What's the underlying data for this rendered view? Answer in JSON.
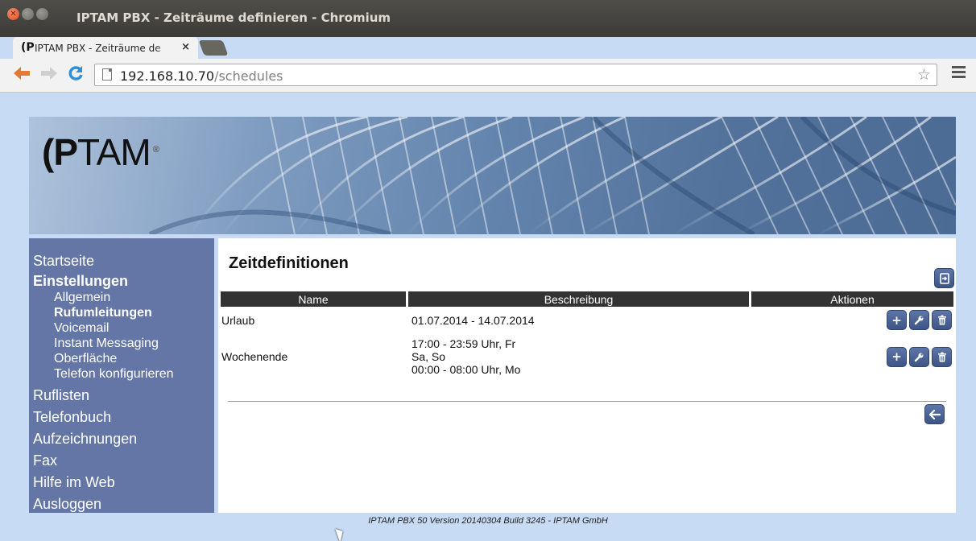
{
  "window": {
    "title": "IPTAM PBX - Zeiträume definieren - Chromium",
    "close_glyph": "✕"
  },
  "tab": {
    "favicon_text": "(P",
    "title": "IPTAM PBX - Zeiträume de",
    "close_glyph": "×"
  },
  "toolbar": {
    "url_host": "192.168.10.70",
    "url_path": "/schedules",
    "back_glyph": "🡐",
    "forward_glyph": "➡",
    "reload_glyph": "C",
    "star_glyph": "☆"
  },
  "banner": {
    "logo_bold": "(P",
    "logo_thin": "TAM",
    "logo_mark": "®"
  },
  "sidebar": {
    "startseite": "Startseite",
    "einstellungen": "Einstellungen",
    "sub_items": [
      "Allgemein",
      "Rufumleitungen",
      "Voicemail",
      "Instant Messaging",
      "Oberfläche",
      "Telefon konfigurieren"
    ],
    "ruflisten": "Ruflisten",
    "telefonbuch": "Telefonbuch",
    "aufzeichnungen": "Aufzeichnungen",
    "fax": "Fax",
    "hilfe": "Hilfe im Web",
    "ausloggen": "Ausloggen"
  },
  "main": {
    "heading": "Zeitdefinitionen",
    "columns": [
      "Name",
      "Beschreibung",
      "Aktionen"
    ],
    "rows": [
      {
        "name": "Urlaub",
        "desc": [
          "01.07.2014 - 14.07.2014"
        ]
      },
      {
        "name": "Wochenende",
        "desc": [
          "17:00 - 23:59 Uhr, Fr",
          "Sa, So",
          "00:00 - 08:00 Uhr, Mo"
        ]
      }
    ],
    "action_glyphs": {
      "add": "+",
      "edit": "🔧",
      "delete": "🗑",
      "export": "⇲",
      "back": "←"
    }
  },
  "footer": "IPTAM PBX 50 Version 20140304 Build 3245 - IPTAM GmbH",
  "colors": {
    "sidebar_bg": "#6476a6",
    "page_bg": "#c7dcf4",
    "header_bg": "#333333",
    "button_blue": "#4a6394"
  }
}
